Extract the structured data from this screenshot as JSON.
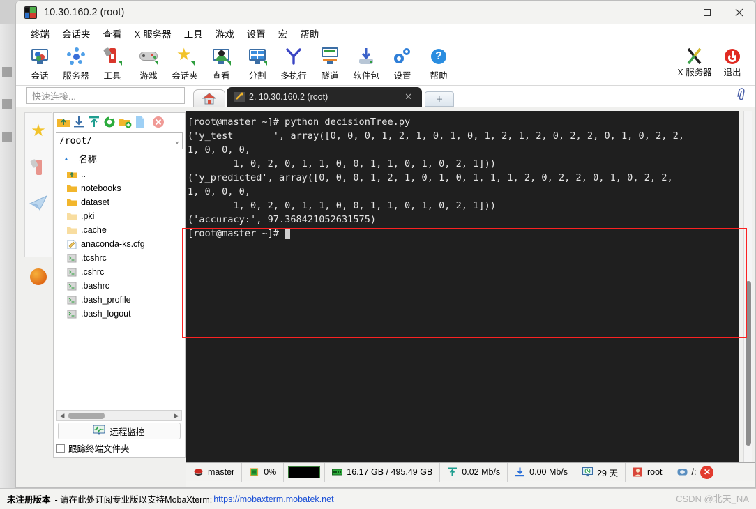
{
  "window": {
    "title": "10.30.160.2 (root)",
    "minimize": "—",
    "maximize": "▢",
    "close": "✕"
  },
  "menubar": {
    "items": [
      {
        "label": "终端",
        "name": "menu-terminal"
      },
      {
        "label": "会话夹",
        "name": "menu-sessions"
      },
      {
        "label": "查看",
        "name": "menu-view"
      },
      {
        "label": "X 服务器",
        "name": "menu-xserver"
      },
      {
        "label": "工具",
        "name": "menu-tools"
      },
      {
        "label": "游戏",
        "name": "menu-games"
      },
      {
        "label": "设置",
        "name": "menu-settings"
      },
      {
        "label": "宏",
        "name": "menu-macros"
      },
      {
        "label": "帮助",
        "name": "menu-help"
      }
    ]
  },
  "toolbar": {
    "buttons": [
      {
        "label": "会话",
        "icon": "session-icon"
      },
      {
        "label": "服务器",
        "icon": "servers-icon"
      },
      {
        "label": "工具",
        "icon": "tools-icon"
      },
      {
        "label": "游戏",
        "icon": "games-icon"
      },
      {
        "label": "会话夹",
        "icon": "sessions-folder-icon"
      },
      {
        "label": "查看",
        "icon": "view-icon"
      },
      {
        "label": "分割",
        "icon": "split-icon"
      },
      {
        "label": "多执行",
        "icon": "multiexec-icon"
      },
      {
        "label": "隧道",
        "icon": "tunneling-icon"
      },
      {
        "label": "软件包",
        "icon": "packages-icon"
      },
      {
        "label": "设置",
        "icon": "settings-icon"
      },
      {
        "label": "帮助",
        "icon": "help-icon"
      }
    ],
    "right_buttons": [
      {
        "label": "X 服务器",
        "icon": "xserver-icon"
      },
      {
        "label": "退出",
        "icon": "exit-icon"
      }
    ]
  },
  "quick_connect": {
    "placeholder": "快速连接..."
  },
  "tabs": {
    "home_icon": "home-icon",
    "session_tab": {
      "label": "2. 10.30.160.2 (root)",
      "icon": "key-icon",
      "close": "✕"
    },
    "add_tab": "＋",
    "clip_icon": "paperclip-icon"
  },
  "rail": {
    "items": [
      {
        "name": "rail-favorites",
        "icon": "star-icon"
      },
      {
        "name": "rail-tools",
        "icon": "swiss-knife-icon"
      },
      {
        "name": "rail-sftp",
        "icon": "paper-plane-icon"
      }
    ],
    "extra": {
      "name": "rail-globe",
      "icon": "globe-icon"
    }
  },
  "sftp": {
    "toolbar_icons": [
      "up-folder-icon",
      "download-icon",
      "upload-icon",
      "refresh-icon",
      "new-folder-icon",
      "new-file-icon",
      "delete-icon"
    ],
    "path": "/root/",
    "path_caret": "⌄",
    "column_header": "名称",
    "sort_arrow": "▲",
    "files": [
      {
        "name": "..",
        "type": "parent"
      },
      {
        "name": "notebooks",
        "type": "folder"
      },
      {
        "name": "dataset",
        "type": "folder"
      },
      {
        "name": ".pki",
        "type": "folder-hidden"
      },
      {
        "name": ".cache",
        "type": "folder-hidden"
      },
      {
        "name": "anaconda-ks.cfg",
        "type": "file-cfg"
      },
      {
        "name": ".tcshrc",
        "type": "file-script"
      },
      {
        "name": ".cshrc",
        "type": "file-script"
      },
      {
        "name": ".bashrc",
        "type": "file-script"
      },
      {
        "name": ".bash_profile",
        "type": "file-script"
      },
      {
        "name": ".bash_logout",
        "type": "file-script"
      }
    ],
    "hscroll": {
      "left": "◀",
      "right": "▶"
    },
    "monitor_button": {
      "label": "远程监控",
      "icon": "monitor-icon"
    },
    "follow_checkbox": {
      "label": "跟踪终端文件夹",
      "checked": false
    }
  },
  "terminal": {
    "lines": [
      "[root@master ~]# python decisionTree.py",
      "('y_test       ', array([0, 0, 0, 1, 2, 1, 0, 1, 0, 1, 2, 1, 2, 0, 2, 2, 0, 1, 0, 2, 2,",
      "1, 0, 0, 0,",
      "        1, 0, 2, 0, 1, 1, 0, 0, 1, 1, 0, 1, 0, 2, 1]))",
      "('y_predicted', array([0, 0, 0, 1, 2, 1, 0, 1, 0, 1, 1, 1, 2, 0, 2, 2, 0, 1, 0, 2, 2,",
      "1, 0, 0, 0,",
      "        1, 0, 2, 0, 1, 1, 0, 0, 1, 1, 0, 1, 0, 2, 1]))",
      "('accuracy:', 97.368421052631575)",
      "[root@master ~]# "
    ],
    "cursor": "█",
    "highlight_color": "#fb2222"
  },
  "statusbar": {
    "cells": [
      {
        "icon": "redhat-icon",
        "label": "master"
      },
      {
        "icon": "cpu-icon",
        "label": "0%"
      },
      {
        "icon": "graph-icon",
        "label": ""
      },
      {
        "icon": "memory-icon",
        "label": "16.17 GB / 495.49 GB"
      },
      {
        "icon": "upload-arrow-icon",
        "label": "0.02 Mb/s"
      },
      {
        "icon": "download-arrow-icon",
        "label": "0.00 Mb/s"
      },
      {
        "icon": "uptime-icon",
        "label": "29 天"
      },
      {
        "icon": "user-icon",
        "label": "root"
      },
      {
        "icon": "disk-icon",
        "label": "/:"
      }
    ],
    "close_label": "✕"
  },
  "banner": {
    "bold": "未注册版本",
    "text": "- 请在此处订阅专业版以支持MobaXterm:",
    "link": "https://mobaxterm.mobatek.net"
  },
  "watermark": "CSDN @北天_NA"
}
